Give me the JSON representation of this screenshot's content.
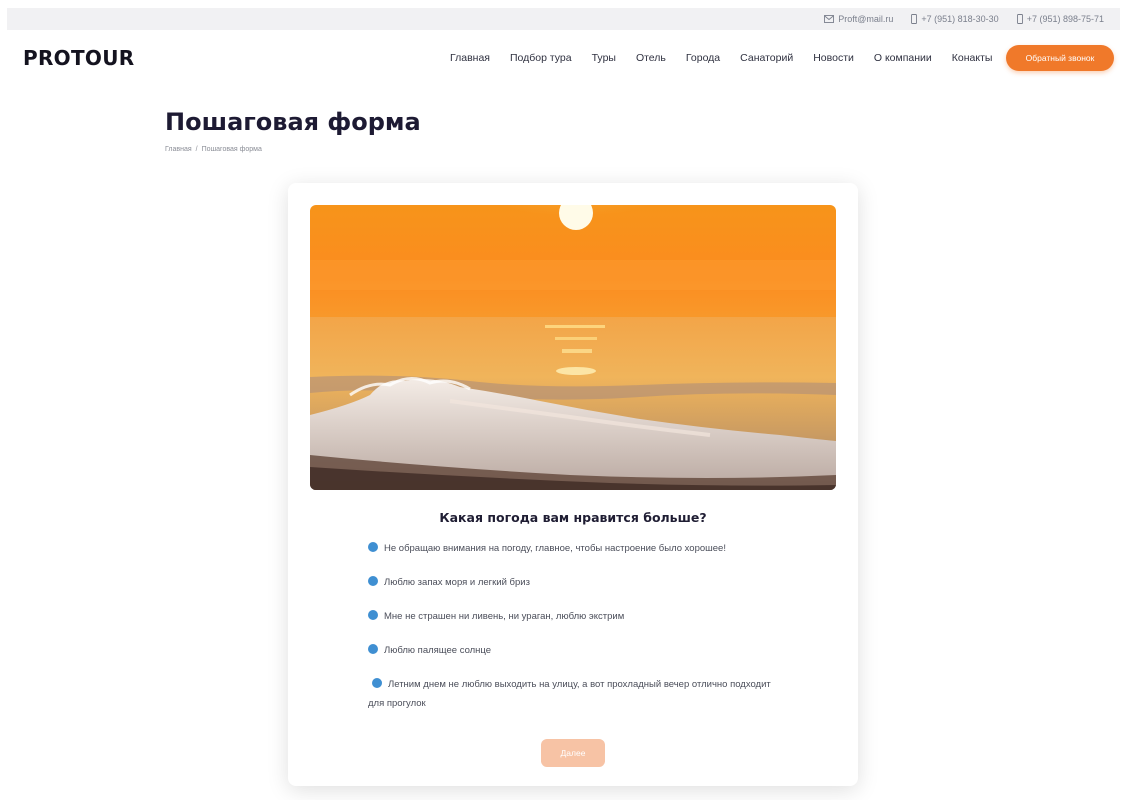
{
  "topbar": {
    "email": "Proft@mail.ru",
    "phone1": "+7 (951) 818-30-30",
    "phone2": "+7 (951) 898-75-71"
  },
  "header": {
    "logo": "PROTOUR",
    "nav": [
      "Главная",
      "Подбор тура",
      "Туры",
      "Отель",
      "Города",
      "Санаторий",
      "Новости",
      "О компании",
      "Конакты"
    ],
    "callback_label": "Обратный звонок"
  },
  "page": {
    "title": "Пошаговая форма",
    "breadcrumb": [
      "Главная",
      "/",
      "Пошаговая форма"
    ]
  },
  "quiz": {
    "question": "Какая погода вам нравится больше?",
    "options": [
      "Не обращаю внимания на погоду, главное, чтобы настроение было хорошее!",
      "Люблю запах моря и легкий бриз",
      "Мне не страшен ни ливень, ни ураган, люблю экстрим",
      "Люблю палящее солнце",
      "Летним днем не люблю выходить на улицу, а вот прохладный вечер отлично подходит для прогулок"
    ],
    "next_label": "Далее"
  },
  "colors": {
    "accent": "#f0792a",
    "radio": "#3f8fd2",
    "next_disabled": "#f7c3a5",
    "title": "#1d1a33"
  },
  "icons": {
    "email": "envelope-icon",
    "phone": "phone-icon",
    "radio": "radio-dot-icon"
  }
}
